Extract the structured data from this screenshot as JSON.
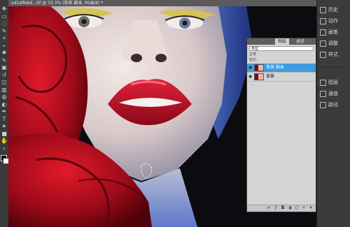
{
  "document": {
    "tab_label": "ad1affeb6...tif @ 33.3% (背景 副本, RGB/8) *",
    "close_glyph": "×"
  },
  "tools": [
    "move",
    "marquee",
    "lasso",
    "quick-select",
    "crop",
    "eyedropper",
    "heal",
    "brush",
    "stamp",
    "history-brush",
    "eraser",
    "gradient",
    "blur",
    "dodge",
    "pen",
    "type",
    "path-select",
    "shape",
    "hand",
    "zoom"
  ],
  "dock": {
    "items": [
      {
        "icon": "history-icon",
        "label": "历史"
      },
      {
        "icon": "actions-icon",
        "label": "动作"
      },
      {
        "icon": "brush-icon",
        "label": "画笔"
      },
      {
        "icon": "adjust-icon",
        "label": "调整"
      },
      {
        "icon": "styles-icon",
        "label": "样式"
      },
      {
        "icon": "layers-icon",
        "label": "图层"
      },
      {
        "icon": "channels-icon",
        "label": "通道"
      },
      {
        "icon": "paths-icon",
        "label": "路径"
      }
    ]
  },
  "layers_panel": {
    "tab_active": "图层",
    "tab_other": "通道",
    "kind_filter": "类型",
    "blend_mode": "正常",
    "lock_label": "锁定:",
    "layers": [
      {
        "name": "背景 副本",
        "selected": true,
        "visible": true
      },
      {
        "name": "背景",
        "selected": false,
        "visible": true
      }
    ],
    "footer_buttons": [
      "link-icon",
      "fx-icon",
      "mask-icon",
      "adjustment-icon",
      "group-icon",
      "new-layer-icon",
      "trash-icon"
    ]
  },
  "colors": {
    "selected_layer": "#3f9be0",
    "panel_bg": "#d4d4d4",
    "app_bg": "#2b2b2b"
  }
}
